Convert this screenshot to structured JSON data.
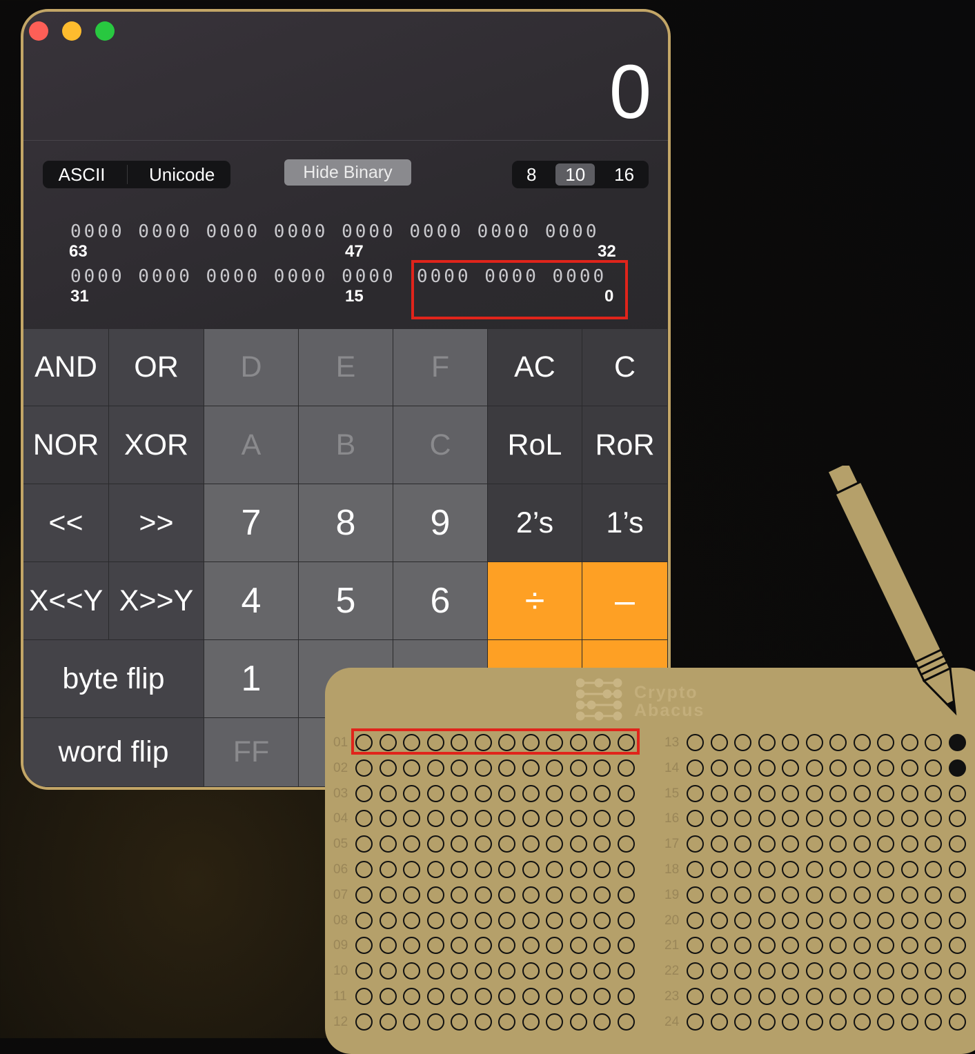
{
  "window": {
    "traffic_lights": [
      "close-button",
      "minimize-button",
      "zoom-button"
    ]
  },
  "display": {
    "value": "0"
  },
  "encoding": {
    "ascii": "ASCII",
    "unicode": "Unicode"
  },
  "hide_binary": "Hide Binary",
  "base": {
    "b8": "8",
    "b10": "10",
    "b16": "16",
    "selected": "10"
  },
  "binary": {
    "row1": "0000 0000 0000 0000 0000 0000 0000 0000",
    "row1_labels": [
      "63",
      "47",
      "32"
    ],
    "row2a": "0000 0000 0000 0000 0000",
    "row2b": "0000 0000 0000",
    "row2_labels": [
      "31",
      "15",
      "0"
    ]
  },
  "keys": {
    "and": "AND",
    "or": "OR",
    "d": "D",
    "e": "E",
    "f": "F",
    "ac": "AC",
    "c": "C",
    "nor": "NOR",
    "xor": "XOR",
    "a": "A",
    "b": "B",
    "c_hex": "C",
    "rol": "RoL",
    "ror": "RoR",
    "shl": "<<",
    "shr": ">>",
    "seven": "7",
    "eight": "8",
    "nine": "9",
    "twos": "2’s",
    "ones": "1’s",
    "xshly": "X<<Y",
    "xshry": "X>>Y",
    "four": "4",
    "five": "5",
    "six": "6",
    "divide": "÷",
    "minus": "–",
    "byte_flip": "byte flip",
    "one": "1",
    "word_flip": "word flip",
    "ff": "FF"
  },
  "abacus": {
    "brand_line1": "Crypto",
    "brand_line2": "Abacus",
    "rows_left": [
      "01",
      "02",
      "03",
      "04",
      "05",
      "06",
      "07",
      "08",
      "09",
      "10",
      "11",
      "12"
    ],
    "rows_right": [
      "13",
      "14",
      "15",
      "16",
      "17",
      "18",
      "19",
      "20",
      "21",
      "22",
      "23",
      "24"
    ],
    "filled": {
      "13": 1,
      "14": 1
    }
  },
  "colors": {
    "orange": "#fea024",
    "highlight": "#e0241b",
    "gold": "#b5a06a"
  }
}
